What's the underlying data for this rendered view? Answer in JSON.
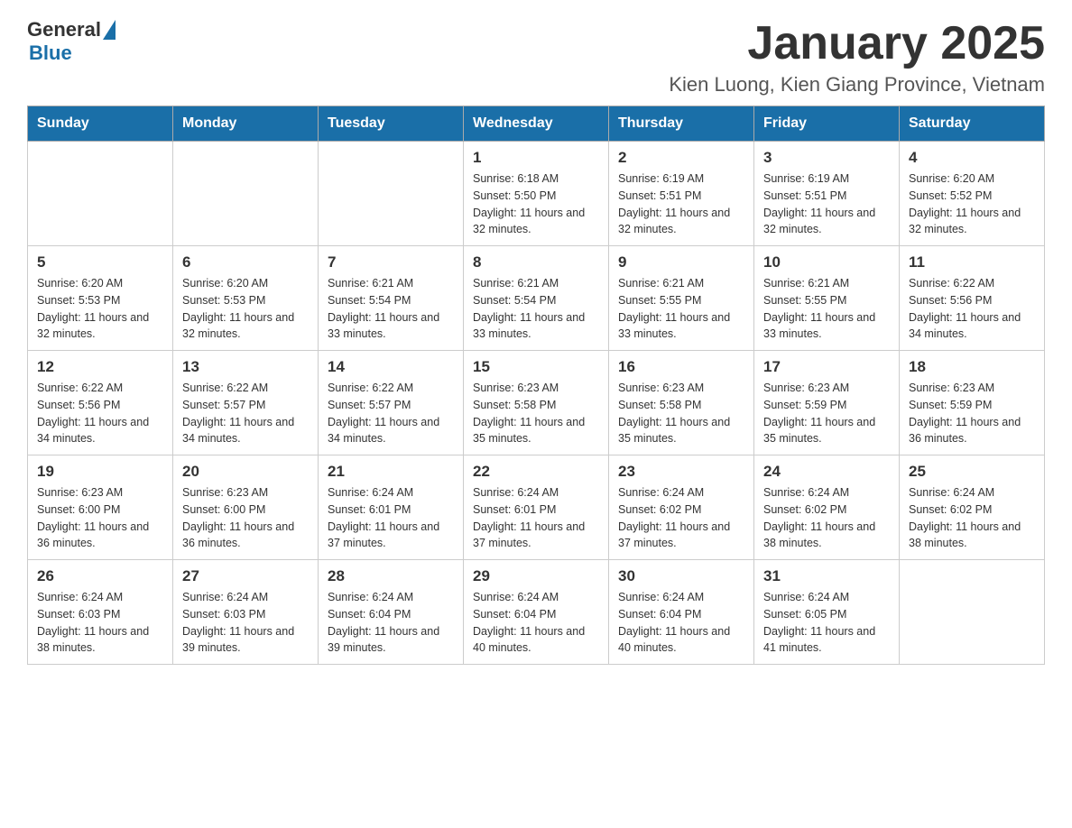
{
  "header": {
    "logo_general": "General",
    "logo_blue": "Blue",
    "month_title": "January 2025",
    "location": "Kien Luong, Kien Giang Province, Vietnam"
  },
  "weekdays": [
    "Sunday",
    "Monday",
    "Tuesday",
    "Wednesday",
    "Thursday",
    "Friday",
    "Saturday"
  ],
  "weeks": [
    [
      {
        "day": "",
        "info": ""
      },
      {
        "day": "",
        "info": ""
      },
      {
        "day": "",
        "info": ""
      },
      {
        "day": "1",
        "info": "Sunrise: 6:18 AM\nSunset: 5:50 PM\nDaylight: 11 hours\nand 32 minutes."
      },
      {
        "day": "2",
        "info": "Sunrise: 6:19 AM\nSunset: 5:51 PM\nDaylight: 11 hours\nand 32 minutes."
      },
      {
        "day": "3",
        "info": "Sunrise: 6:19 AM\nSunset: 5:51 PM\nDaylight: 11 hours\nand 32 minutes."
      },
      {
        "day": "4",
        "info": "Sunrise: 6:20 AM\nSunset: 5:52 PM\nDaylight: 11 hours\nand 32 minutes."
      }
    ],
    [
      {
        "day": "5",
        "info": "Sunrise: 6:20 AM\nSunset: 5:53 PM\nDaylight: 11 hours\nand 32 minutes."
      },
      {
        "day": "6",
        "info": "Sunrise: 6:20 AM\nSunset: 5:53 PM\nDaylight: 11 hours\nand 32 minutes."
      },
      {
        "day": "7",
        "info": "Sunrise: 6:21 AM\nSunset: 5:54 PM\nDaylight: 11 hours\nand 33 minutes."
      },
      {
        "day": "8",
        "info": "Sunrise: 6:21 AM\nSunset: 5:54 PM\nDaylight: 11 hours\nand 33 minutes."
      },
      {
        "day": "9",
        "info": "Sunrise: 6:21 AM\nSunset: 5:55 PM\nDaylight: 11 hours\nand 33 minutes."
      },
      {
        "day": "10",
        "info": "Sunrise: 6:21 AM\nSunset: 5:55 PM\nDaylight: 11 hours\nand 33 minutes."
      },
      {
        "day": "11",
        "info": "Sunrise: 6:22 AM\nSunset: 5:56 PM\nDaylight: 11 hours\nand 34 minutes."
      }
    ],
    [
      {
        "day": "12",
        "info": "Sunrise: 6:22 AM\nSunset: 5:56 PM\nDaylight: 11 hours\nand 34 minutes."
      },
      {
        "day": "13",
        "info": "Sunrise: 6:22 AM\nSunset: 5:57 PM\nDaylight: 11 hours\nand 34 minutes."
      },
      {
        "day": "14",
        "info": "Sunrise: 6:22 AM\nSunset: 5:57 PM\nDaylight: 11 hours\nand 34 minutes."
      },
      {
        "day": "15",
        "info": "Sunrise: 6:23 AM\nSunset: 5:58 PM\nDaylight: 11 hours\nand 35 minutes."
      },
      {
        "day": "16",
        "info": "Sunrise: 6:23 AM\nSunset: 5:58 PM\nDaylight: 11 hours\nand 35 minutes."
      },
      {
        "day": "17",
        "info": "Sunrise: 6:23 AM\nSunset: 5:59 PM\nDaylight: 11 hours\nand 35 minutes."
      },
      {
        "day": "18",
        "info": "Sunrise: 6:23 AM\nSunset: 5:59 PM\nDaylight: 11 hours\nand 36 minutes."
      }
    ],
    [
      {
        "day": "19",
        "info": "Sunrise: 6:23 AM\nSunset: 6:00 PM\nDaylight: 11 hours\nand 36 minutes."
      },
      {
        "day": "20",
        "info": "Sunrise: 6:23 AM\nSunset: 6:00 PM\nDaylight: 11 hours\nand 36 minutes."
      },
      {
        "day": "21",
        "info": "Sunrise: 6:24 AM\nSunset: 6:01 PM\nDaylight: 11 hours\nand 37 minutes."
      },
      {
        "day": "22",
        "info": "Sunrise: 6:24 AM\nSunset: 6:01 PM\nDaylight: 11 hours\nand 37 minutes."
      },
      {
        "day": "23",
        "info": "Sunrise: 6:24 AM\nSunset: 6:02 PM\nDaylight: 11 hours\nand 37 minutes."
      },
      {
        "day": "24",
        "info": "Sunrise: 6:24 AM\nSunset: 6:02 PM\nDaylight: 11 hours\nand 38 minutes."
      },
      {
        "day": "25",
        "info": "Sunrise: 6:24 AM\nSunset: 6:02 PM\nDaylight: 11 hours\nand 38 minutes."
      }
    ],
    [
      {
        "day": "26",
        "info": "Sunrise: 6:24 AM\nSunset: 6:03 PM\nDaylight: 11 hours\nand 38 minutes."
      },
      {
        "day": "27",
        "info": "Sunrise: 6:24 AM\nSunset: 6:03 PM\nDaylight: 11 hours\nand 39 minutes."
      },
      {
        "day": "28",
        "info": "Sunrise: 6:24 AM\nSunset: 6:04 PM\nDaylight: 11 hours\nand 39 minutes."
      },
      {
        "day": "29",
        "info": "Sunrise: 6:24 AM\nSunset: 6:04 PM\nDaylight: 11 hours\nand 40 minutes."
      },
      {
        "day": "30",
        "info": "Sunrise: 6:24 AM\nSunset: 6:04 PM\nDaylight: 11 hours\nand 40 minutes."
      },
      {
        "day": "31",
        "info": "Sunrise: 6:24 AM\nSunset: 6:05 PM\nDaylight: 11 hours\nand 41 minutes."
      },
      {
        "day": "",
        "info": ""
      }
    ]
  ]
}
